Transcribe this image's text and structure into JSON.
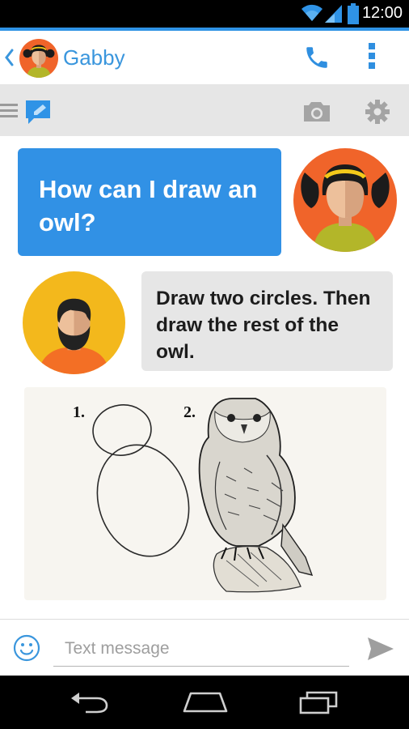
{
  "status_bar": {
    "time": "12:00"
  },
  "header": {
    "contact_name": "Gabby"
  },
  "conversation": {
    "messages": [
      {
        "from": "me",
        "text": "How can I draw an owl?"
      },
      {
        "from": "contact",
        "text": "Draw two circles. Then draw the rest of the owl."
      }
    ],
    "image": {
      "step_labels": [
        "1.",
        "2."
      ]
    }
  },
  "compose": {
    "placeholder": "Text message"
  },
  "colors": {
    "accent": "#2f93e6",
    "outgoing_bubble": "#3191e5",
    "incoming_bubble": "#e6e6e6",
    "avatar_orange": "#f0642a",
    "avatar_yellow": "#f3b81c"
  },
  "icons": [
    "back-icon",
    "call-icon",
    "overflow-icon",
    "menu-icon",
    "compose-icon",
    "camera-icon",
    "settings-icon",
    "emoji-icon",
    "send-icon",
    "nav-back-icon",
    "nav-home-icon",
    "nav-recents-icon",
    "wifi-icon",
    "signal-icon",
    "battery-icon"
  ]
}
